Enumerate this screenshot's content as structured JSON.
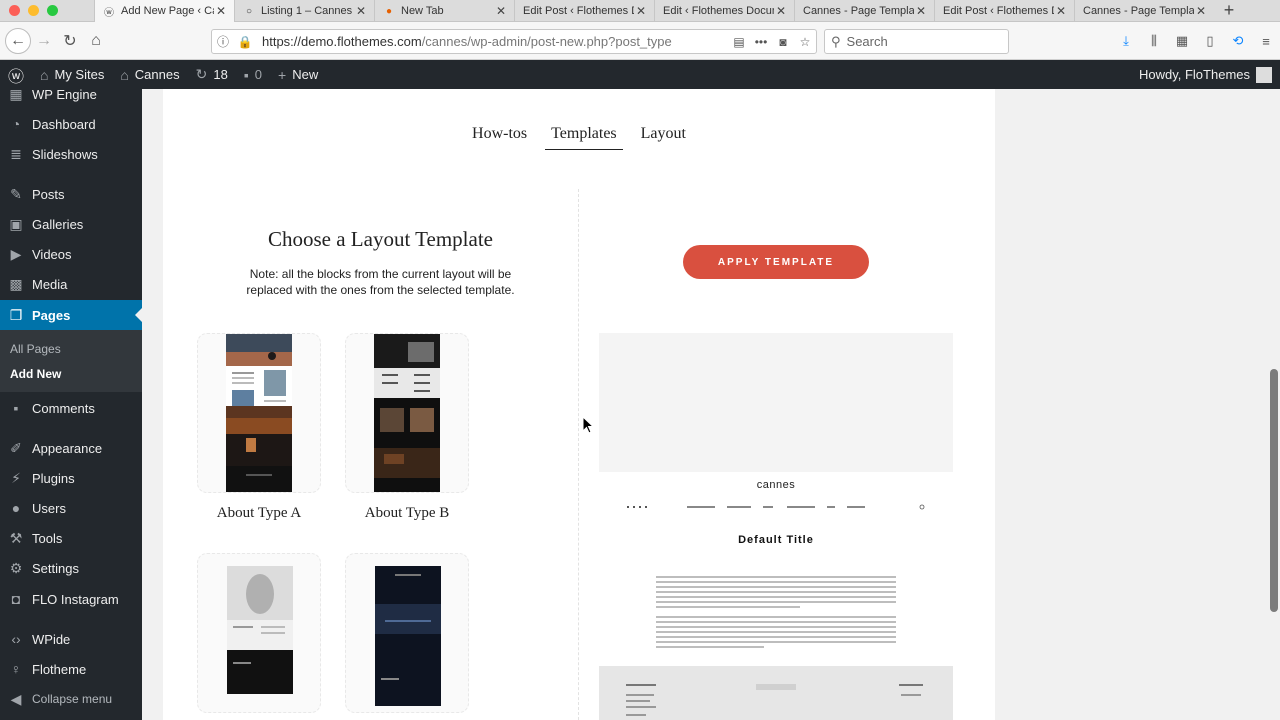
{
  "browser": {
    "tabs": [
      {
        "title": "Add New Page ‹ Cannes",
        "active": true
      },
      {
        "title": "Listing 1 – Cannes",
        "active": false
      },
      {
        "title": "New Tab",
        "active": false
      },
      {
        "title": "Edit Post ‹ Flothemes D",
        "active": false
      },
      {
        "title": "Edit ‹ Flothemes Docum",
        "active": false
      },
      {
        "title": "Cannes - Page Templat",
        "active": false
      },
      {
        "title": "Edit Post ‹ Flothemes D",
        "active": false
      },
      {
        "title": "Cannes - Page Templat",
        "active": false
      }
    ],
    "url_main": "https://demo.flothemes.com",
    "url_rest": "/cannes/wp-admin/post-new.php?post_type",
    "search_placeholder": "Search"
  },
  "adminbar": {
    "my_sites": "My Sites",
    "site": "Cannes",
    "updates": "18",
    "comments": "0",
    "new": "New",
    "howdy": "Howdy, FloThemes"
  },
  "sidebar": {
    "items": [
      {
        "label": "WP Engine",
        "icon": "wp-engine-icon"
      },
      {
        "label": "Dashboard",
        "icon": "dashboard-icon"
      },
      {
        "label": "Slideshows",
        "icon": "slideshows-icon"
      },
      {
        "label": "Posts",
        "icon": "posts-icon"
      },
      {
        "label": "Galleries",
        "icon": "galleries-icon"
      },
      {
        "label": "Videos",
        "icon": "videos-icon"
      },
      {
        "label": "Media",
        "icon": "media-icon"
      },
      {
        "label": "Pages",
        "icon": "pages-icon"
      },
      {
        "label": "Comments",
        "icon": "comments-icon"
      },
      {
        "label": "Appearance",
        "icon": "appearance-icon"
      },
      {
        "label": "Plugins",
        "icon": "plugins-icon"
      },
      {
        "label": "Users",
        "icon": "users-icon"
      },
      {
        "label": "Tools",
        "icon": "tools-icon"
      },
      {
        "label": "Settings",
        "icon": "settings-icon"
      },
      {
        "label": "FLO Instagram",
        "icon": "instagram-icon"
      },
      {
        "label": "WPide",
        "icon": "wpide-icon"
      },
      {
        "label": "Flotheme",
        "icon": "flotheme-icon"
      },
      {
        "label": "Collapse menu",
        "icon": "collapse-icon"
      }
    ],
    "submenu": {
      "all_pages": "All Pages",
      "add_new": "Add New"
    }
  },
  "main": {
    "tabs": [
      "How-tos",
      "Templates",
      "Layout"
    ],
    "active_tab": "Templates",
    "heading": "Choose a Layout Template",
    "note_line1": "Note: all the blocks from the current layout will be",
    "note_line2": "replaced with the ones from the selected template.",
    "apply_button": "APPLY TEMPLATE",
    "templates": [
      {
        "label": "About Type A"
      },
      {
        "label": "About Type B"
      },
      {
        "label": ""
      },
      {
        "label": ""
      }
    ],
    "preview": {
      "brand": "cannes",
      "page_title": "Default Title"
    }
  },
  "colors": {
    "wp_dark": "#23282d",
    "wp_blue": "#0073aa",
    "apply_red": "#d9503f"
  }
}
